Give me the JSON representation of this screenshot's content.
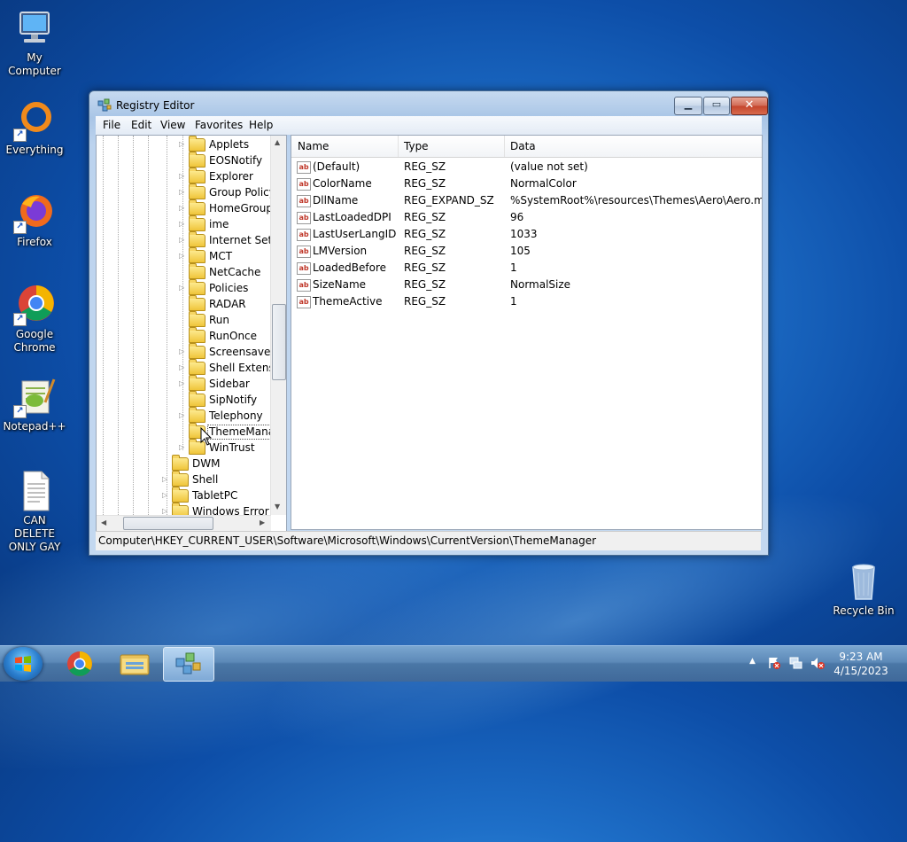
{
  "desktop": {
    "icons": [
      {
        "label": "My Computer",
        "icon": "computer-icon"
      },
      {
        "label": "Everything",
        "icon": "everything-icon"
      },
      {
        "label": "Firefox",
        "icon": "firefox-icon"
      },
      {
        "label": "Google Chrome",
        "icon": "chrome-icon"
      },
      {
        "label": "Notepad++",
        "icon": "notepadpp-icon"
      },
      {
        "label": "CAN DELETE ONLY GAY",
        "icon": "text-file-icon"
      },
      {
        "label": "Recycle Bin",
        "icon": "recycle-bin-icon"
      }
    ]
  },
  "window": {
    "title": "Registry Editor",
    "menu": [
      "File",
      "Edit",
      "View",
      "Favorites",
      "Help"
    ],
    "tree": {
      "items": [
        {
          "label": "Applets",
          "expandable": true
        },
        {
          "label": "EOSNotify",
          "expandable": false
        },
        {
          "label": "Explorer",
          "expandable": true
        },
        {
          "label": "Group Policy",
          "expandable": true
        },
        {
          "label": "HomeGroup",
          "expandable": true
        },
        {
          "label": "ime",
          "expandable": true
        },
        {
          "label": "Internet Settings",
          "expandable": true
        },
        {
          "label": "MCT",
          "expandable": true
        },
        {
          "label": "NetCache",
          "expandable": false
        },
        {
          "label": "Policies",
          "expandable": true
        },
        {
          "label": "RADAR",
          "expandable": false
        },
        {
          "label": "Run",
          "expandable": false
        },
        {
          "label": "RunOnce",
          "expandable": false
        },
        {
          "label": "Screensavers",
          "expandable": true
        },
        {
          "label": "Shell Extensions",
          "expandable": true
        },
        {
          "label": "Sidebar",
          "expandable": true
        },
        {
          "label": "SipNotify",
          "expandable": false
        },
        {
          "label": "Telephony",
          "expandable": true
        },
        {
          "label": "ThemeManager",
          "expandable": false,
          "selected": true
        },
        {
          "label": "WinTrust",
          "expandable": true
        },
        {
          "label": "DWM",
          "expandable": false,
          "level": "parent"
        },
        {
          "label": "Shell",
          "expandable": true,
          "level": "parent"
        },
        {
          "label": "TabletPC",
          "expandable": true,
          "level": "parent"
        },
        {
          "label": "Windows Error Reporting",
          "expandable": true,
          "level": "parent"
        }
      ]
    },
    "columns": {
      "name": "Name",
      "type": "Type",
      "data": "Data"
    },
    "values": [
      {
        "name": "(Default)",
        "type": "REG_SZ",
        "data": "(value not set)"
      },
      {
        "name": "ColorName",
        "type": "REG_SZ",
        "data": "NormalColor"
      },
      {
        "name": "DllName",
        "type": "REG_EXPAND_SZ",
        "data": "%SystemRoot%\\resources\\Themes\\Aero\\Aero.ms..."
      },
      {
        "name": "LastLoadedDPI",
        "type": "REG_SZ",
        "data": "96"
      },
      {
        "name": "LastUserLangID",
        "type": "REG_SZ",
        "data": "1033"
      },
      {
        "name": "LMVersion",
        "type": "REG_SZ",
        "data": "105"
      },
      {
        "name": "LoadedBefore",
        "type": "REG_SZ",
        "data": "1"
      },
      {
        "name": "SizeName",
        "type": "REG_SZ",
        "data": "NormalSize"
      },
      {
        "name": "ThemeActive",
        "type": "REG_SZ",
        "data": "1"
      }
    ],
    "status": "Computer\\HKEY_CURRENT_USER\\Software\\Microsoft\\Windows\\CurrentVersion\\ThemeManager"
  },
  "taskbar": {
    "pinned": [
      "start-orb-icon",
      "chrome-icon",
      "file-explorer-icon",
      "regedit-icon"
    ],
    "tray": [
      "show-hidden-icons",
      "action-center-icon",
      "network-icon",
      "volume-muted-icon"
    ],
    "time": "9:23 AM",
    "date": "4/15/2023"
  },
  "colors": {
    "desktop_accent": "#1e6fc8",
    "taskbar": "#4a77a6",
    "close_button": "#c4452c"
  }
}
